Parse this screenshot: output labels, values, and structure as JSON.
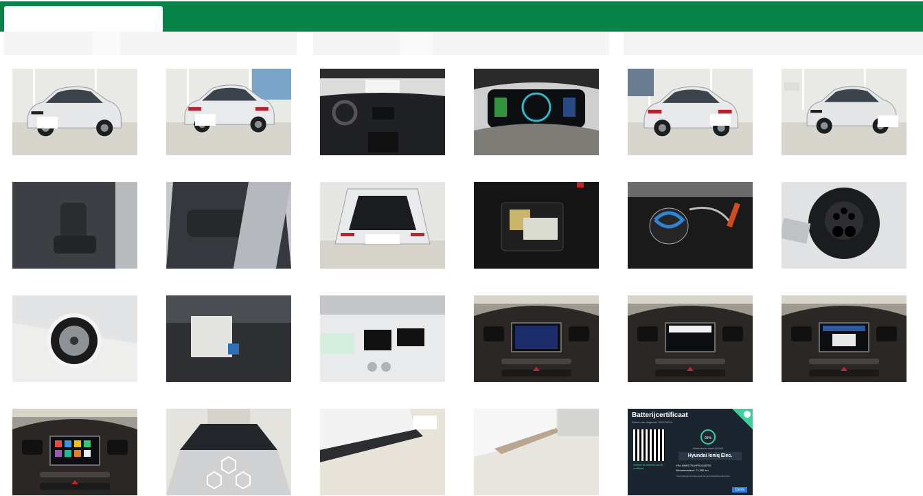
{
  "theme": {
    "brand_green": "#07834a",
    "filter_bg": "#f5f5f5",
    "filter_bg_light": "#fafafa"
  },
  "header": {
    "active_tab_label": ""
  },
  "gallery": {
    "photos": [
      {
        "kind": "car-front"
      },
      {
        "kind": "car-rear"
      },
      {
        "kind": "dashboard"
      },
      {
        "kind": "cluster"
      },
      {
        "kind": "car-rear-alt"
      },
      {
        "kind": "car-front-alt"
      },
      {
        "kind": "front-seat"
      },
      {
        "kind": "rear-seat"
      },
      {
        "kind": "open-trunk"
      },
      {
        "kind": "kit-bag"
      },
      {
        "kind": "charging-cable"
      },
      {
        "kind": "charge-port"
      },
      {
        "kind": "wheel"
      },
      {
        "kind": "documents"
      },
      {
        "kind": "label-sticker"
      },
      {
        "kind": "infotainment-1"
      },
      {
        "kind": "infotainment-2"
      },
      {
        "kind": "infotainment-3"
      },
      {
        "kind": "infotainment-home"
      },
      {
        "kind": "hood"
      },
      {
        "kind": "sill-1"
      },
      {
        "kind": "sill-2"
      },
      {
        "kind": "certificate",
        "cert": {
          "title": "Batterijcertificaat",
          "date_line": "Datum van diagnose: 09/07/2024",
          "soh": "95%",
          "health_caption": "Uitstekende staat (SOH)*",
          "model": "Hyundai Ioniq Elec.",
          "vin_line": "VIN: KMHC751HFKU048752",
          "km_line": "Kilometerstand: 71.282 km",
          "note": "* Het batterijpercentage geeft de gezondheidstoestand aan.",
          "verify": "Verifieer de echtheid van dit certificaat",
          "brand": "Carvis"
        }
      }
    ]
  }
}
